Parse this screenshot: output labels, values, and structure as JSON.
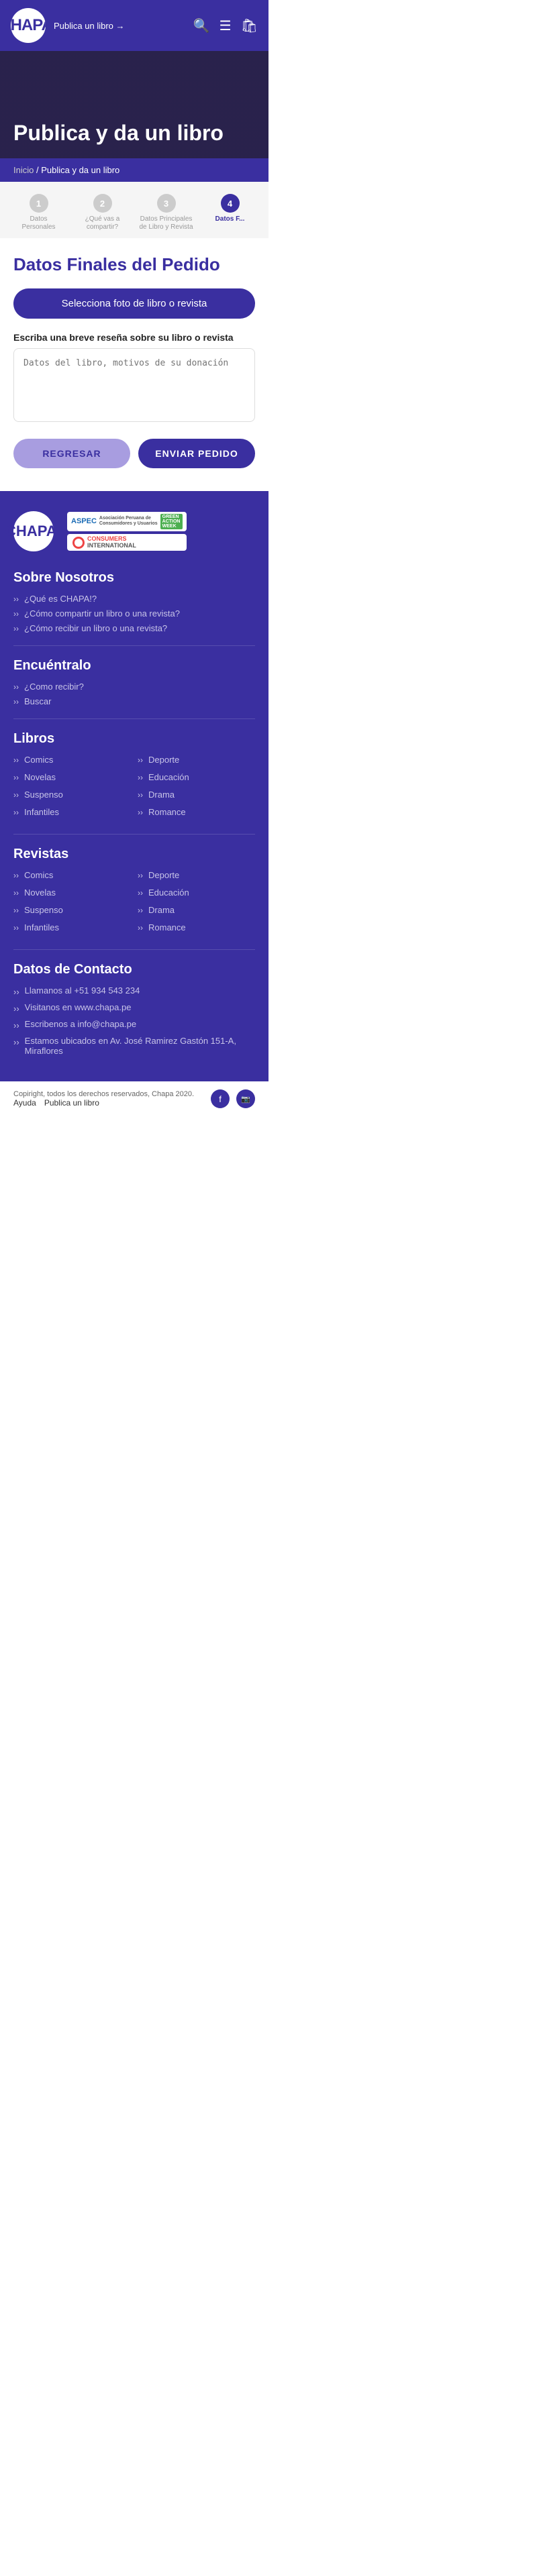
{
  "header": {
    "logo_text": "CHAPA!",
    "publish_label": "Publica un libro →",
    "search_icon": "🔍",
    "menu_icon": "☰",
    "cart_icon": "🛍"
  },
  "hero": {
    "title": "Publica y da un libro"
  },
  "breadcrumb": {
    "home": "Inicio",
    "separator": " / ",
    "current": "Publica y da un libro"
  },
  "steps": [
    {
      "number": "1",
      "label": "Datos\nPersonales",
      "active": false
    },
    {
      "number": "2",
      "label": "¿Qué vas a\ncompartir?",
      "active": false
    },
    {
      "number": "3",
      "label": "Datos Principales\nde Libro y Revista",
      "active": false
    },
    {
      "number": "4",
      "label": "Datos F...",
      "active": true
    }
  ],
  "form": {
    "title": "Datos Finales del Pedido",
    "select_photo_btn": "Selecciona foto de libro o revista",
    "textarea_label": "Escriba una breve reseña sobre su libro o revista",
    "textarea_placeholder": "Datos del libro, motivos de su donación",
    "back_btn": "REGRESAR",
    "send_btn": "ENVIAR PEDIDO"
  },
  "footer": {
    "chapa_logo": "CHAPA!",
    "aspec_label": "ASPEC",
    "aspec_sub": "Asociación Peruana de\nConsumidores y Usuarios",
    "green_action": "GREEN\nACTION\nWEEK",
    "consumers_label": "CONSUMERS\nINTERNATIONAL",
    "about_title": "Sobre Nosotros",
    "about_links": [
      "¿Qué es CHAPA!?",
      "¿Cómo compartir un libro o una revista?",
      "¿Cómo recibir un libro o una revista?"
    ],
    "find_title": "Encuéntralo",
    "find_links": [
      "¿Como recibir?",
      "Buscar"
    ],
    "books_title": "Libros",
    "books_col1": [
      "Comics",
      "Novelas",
      "Suspenso",
      "Infantiles"
    ],
    "books_col2": [
      "Deporte",
      "Educación",
      "Drama",
      "Romance"
    ],
    "magazines_title": "Revistas",
    "magazines_col1": [
      "Comics",
      "Novelas",
      "Suspenso",
      "Infantiles"
    ],
    "magazines_col2": [
      "Deporte",
      "Educación",
      "Drama",
      "Romance"
    ],
    "contact_title": "Datos de Contacto",
    "contact_items": [
      "Llamanos al +51 934 543 234",
      "Visitanos en www.chapa.pe",
      "Escribenos a info@chapa.pe",
      "Estamos ubicados en Av. José Ramirez Gastón 151-A, Miraflores"
    ],
    "copyright": "Copiright, todos los derechos reservados, Chapa 2020.",
    "bottom_links": [
      "Ayuda",
      "Publica un libro"
    ],
    "facebook_icon": "f",
    "instagram_icon": "📷"
  }
}
